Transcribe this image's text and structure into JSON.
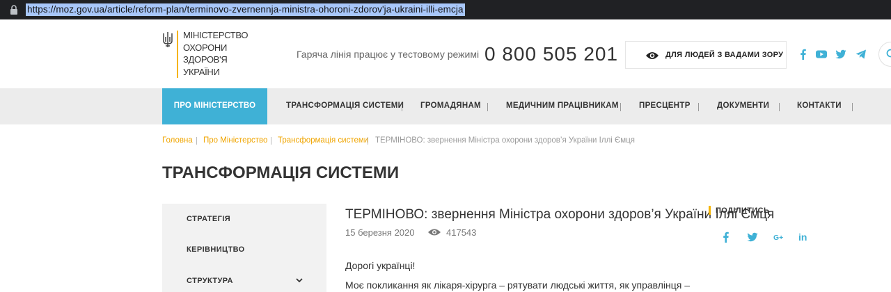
{
  "browser": {
    "url": "https://moz.gov.ua/article/reform-plan/terminovo-zvernennja-ministra-ohoroni-zdorov'ja-ukraini-illi-emcja"
  },
  "header": {
    "logo_lines": [
      "Міністерство",
      "охорони",
      "здоров'я",
      "України"
    ],
    "hotline_label": "Гаряча лінія працює у тестовому режимі",
    "hotline_number": "0 800 505 201",
    "vision_button_label": "ДЛЯ ЛЮДЕЙ З ВАДАМИ ЗОРУ",
    "social_icons": [
      "facebook-icon",
      "youtube-icon",
      "twitter-icon",
      "telegram-icon"
    ],
    "accent_color": "#f5b400"
  },
  "nav": {
    "active_color": "#3fb1d6",
    "items": [
      {
        "label": "ПРО МІНІСТЕРСТВО",
        "active": true
      },
      {
        "label": "ТРАНСФОРМАЦІЯ СИСТЕМИ",
        "active": false
      },
      {
        "label": "ГРОМАДЯНАМ",
        "active": false
      },
      {
        "label": "МЕДИЧНИМ ПРАЦІВНИКАМ",
        "active": false
      },
      {
        "label": "ПРЕСЦЕНТР",
        "active": false
      },
      {
        "label": "ДОКУМЕНТИ",
        "active": false
      },
      {
        "label": "КОНТАКТИ",
        "active": false
      }
    ]
  },
  "breadcrumb": {
    "items": [
      "Головна",
      "Про Міністерство",
      "Трансформація системи",
      "ТЕРМІНОВО: звернення Міністра охорони здоров’я України Іллі Ємця"
    ]
  },
  "page_title": "ТРАНСФОРМАЦІЯ СИСТЕМИ",
  "sidebar": {
    "items": [
      {
        "label": "СТРАТЕГІЯ"
      },
      {
        "label": "КЕРІВНИЦТВО"
      },
      {
        "label": "СТРУКТУРА",
        "expandable": true
      }
    ]
  },
  "article": {
    "title": "ТЕРМІНОВО: звернення Міністра охорони здоров’я України Іллі Ємця",
    "date": "15 березня 2020",
    "views": "417543",
    "paragraphs": [
      "Дорогі українці!",
      "Моє покликання як лікаря-хірурга – рятувати людські життя, як управлінця –"
    ]
  },
  "share": {
    "label": "ПОДІЛИТИСЬ",
    "icons": [
      "facebook-icon",
      "twitter-icon",
      "google-plus-icon",
      "linkedin-icon"
    ],
    "icon_color": "#3fb1d6"
  }
}
